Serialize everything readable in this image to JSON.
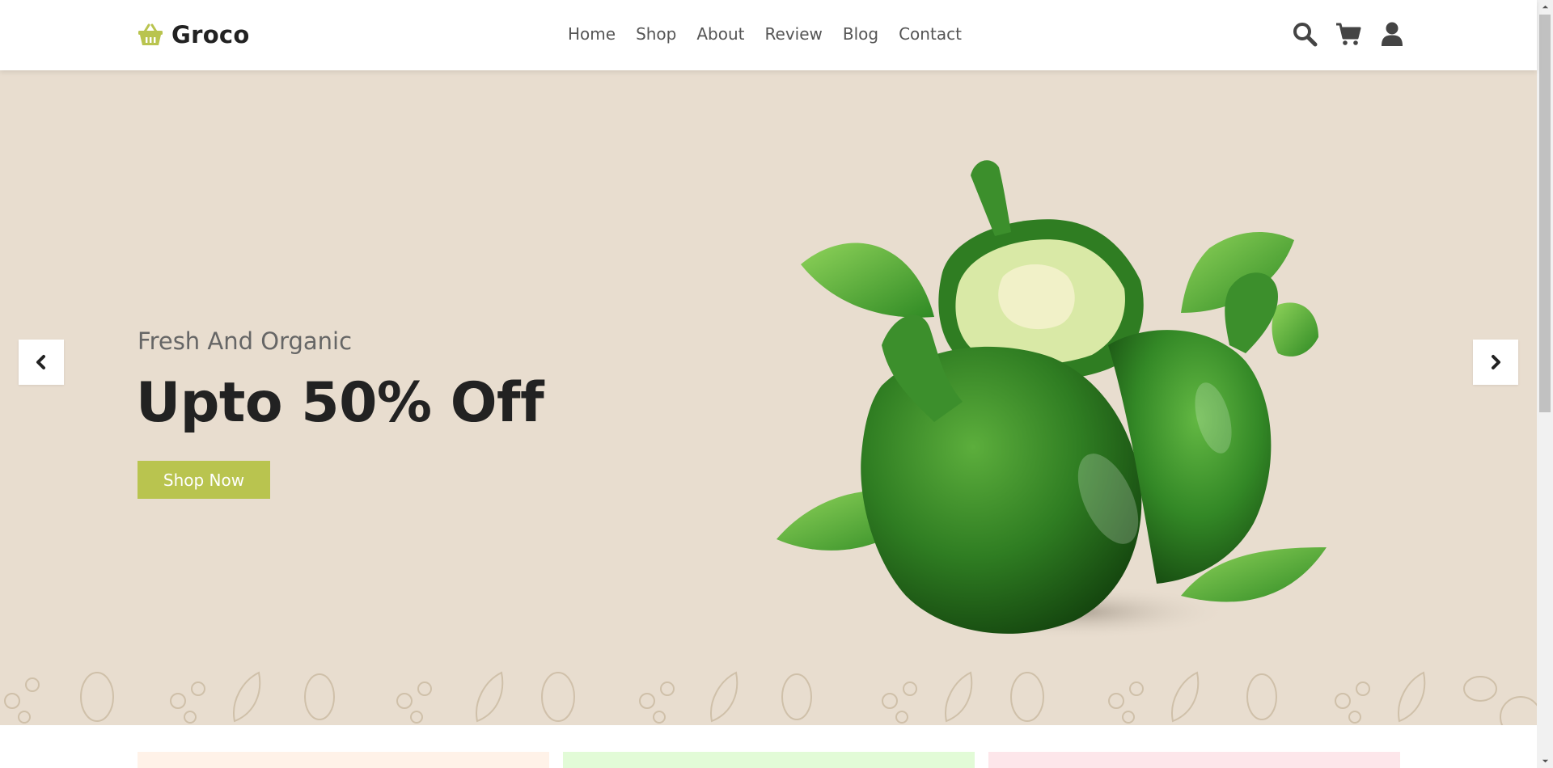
{
  "brand": {
    "name": "Groco",
    "accent_color": "#b9c44f"
  },
  "nav": {
    "items": [
      {
        "label": "Home"
      },
      {
        "label": "Shop"
      },
      {
        "label": "About"
      },
      {
        "label": "Review"
      },
      {
        "label": "Blog"
      },
      {
        "label": "Contact"
      }
    ]
  },
  "header_icons": [
    "search-icon",
    "cart-icon",
    "user-icon"
  ],
  "hero": {
    "subtitle": "Fresh And Organic",
    "title": "Upto 50% Off",
    "button_label": "Shop Now",
    "background_color": "#e8ddcf"
  },
  "carousel": {
    "prev_icon": "chevron-left-icon",
    "next_icon": "chevron-right-icon"
  },
  "cards": [
    {
      "color": "#fff2e8"
    },
    {
      "color": "#e2fbd7"
    },
    {
      "color": "#fde6ea"
    }
  ]
}
